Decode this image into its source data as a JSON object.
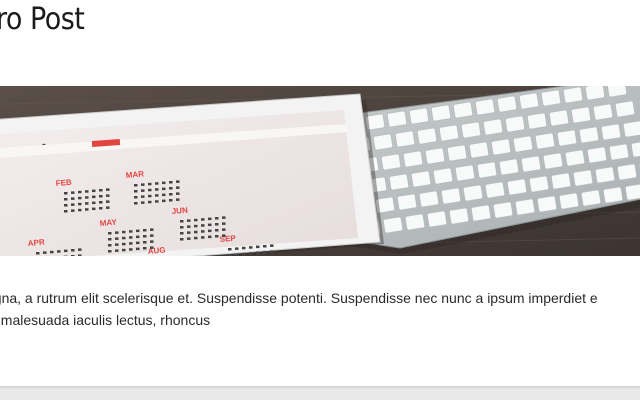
{
  "post": {
    "title": "iro Post",
    "excerpt_line1": "agna, a rutrum elit scelerisque et. Suspendisse potenti. Suspendisse nec nunc a ipsum imperdiet e",
    "excerpt_line2": "bi malesuada iaculis lectus, rhoncus"
  },
  "hero_image": {
    "subject": "tablet-calendar-and-keyboard",
    "calendar_months": [
      "FEB",
      "MAR",
      "MAY",
      "JUN",
      "APR",
      "AUG",
      "SEP"
    ]
  },
  "colors": {
    "page_bg": "#e9e9e9",
    "card_bg": "#ffffff",
    "title": "#1b1b1b",
    "text": "#2a2a2a",
    "calendar_accent": "#e0453f"
  }
}
